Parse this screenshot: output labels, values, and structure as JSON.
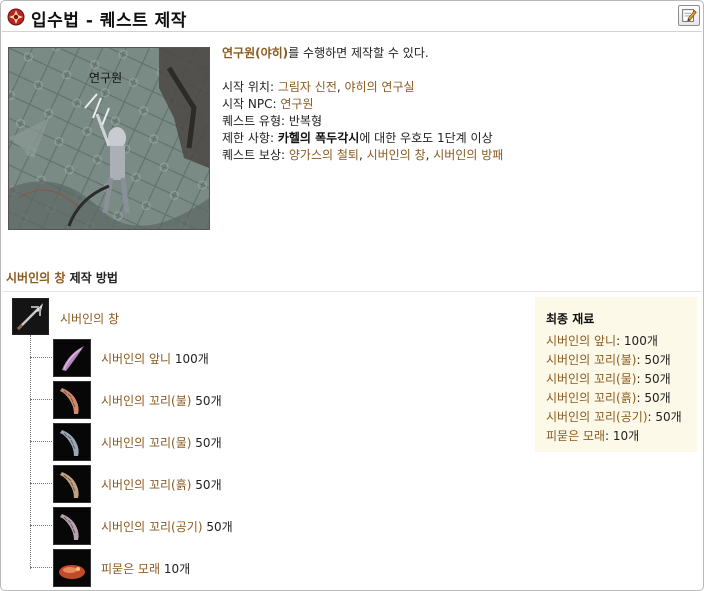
{
  "header": {
    "title": "입수법 - 퀘스트 제작",
    "edit_button_icon": "edit-note-icon"
  },
  "screenshot": {
    "npc_label": "연구원"
  },
  "info": {
    "intro_npc": "연구원(야히)",
    "intro_rest": "를 수행하면 제작할 수 있다.",
    "start_location_label": "시작 위치: ",
    "start_location_1": "그림자 신전",
    "start_location_sep": ", ",
    "start_location_2": "야히의 연구실",
    "start_npc_label": "시작 NPC: ",
    "start_npc_value": "연구원",
    "quest_type_label": "퀘스트 유형: ",
    "quest_type_value": "반복형",
    "restriction_label": "제한 사항: ",
    "restriction_faction": "카헬의 폭두각시",
    "restriction_rest": "에 대한 우호도 1단계 이상",
    "reward_label": "퀘스트 보상: ",
    "reward_1": "양가스의 철퇴",
    "reward_2": "시버인의 창",
    "reward_3": "시버인의 방패",
    "reward_sep": ", "
  },
  "recipe": {
    "title_item": "시버인의 창",
    "title_rest": " 제작 방법",
    "top_item": {
      "name": "시버인의 창",
      "icon": "spear-icon"
    },
    "ingredients": [
      {
        "name": "시버인의 앞니",
        "qty": "100개",
        "icon": "fang-icon",
        "color": "#b789c0"
      },
      {
        "name": "시버인의 꼬리(불)",
        "qty": "50개",
        "icon": "fire-tail-icon",
        "color": "#d08a6c"
      },
      {
        "name": "시버인의 꼬리(물)",
        "qty": "50개",
        "icon": "water-tail-icon",
        "color": "#9aa7b6"
      },
      {
        "name": "시버인의 꼬리(흙)",
        "qty": "50개",
        "icon": "earth-tail-icon",
        "color": "#c4a07c"
      },
      {
        "name": "시버인의 꼬리(공기)",
        "qty": "50개",
        "icon": "air-tail-icon",
        "color": "#b8a0ae"
      },
      {
        "name": "피묻은 모래",
        "qty": "10개",
        "icon": "bloody-sand-icon",
        "color": "#c04a2a"
      }
    ]
  },
  "materials": {
    "title": "최종 재료",
    "items": [
      {
        "name": "시버인의 앞니",
        "qty": ": 100개"
      },
      {
        "name": "시버인의 꼬리(불)",
        "qty": ": 50개"
      },
      {
        "name": "시버인의 꼬리(물)",
        "qty": ": 50개"
      },
      {
        "name": "시버인의 꼬리(흙)",
        "qty": ": 50개"
      },
      {
        "name": "시버인의 꼬리(공기)",
        "qty": ": 50개"
      },
      {
        "name": "피묻은 모래",
        "qty": ": 10개"
      }
    ]
  },
  "colors": {
    "link": "#8a5a20",
    "materials_bg": "#fdf9e8"
  }
}
